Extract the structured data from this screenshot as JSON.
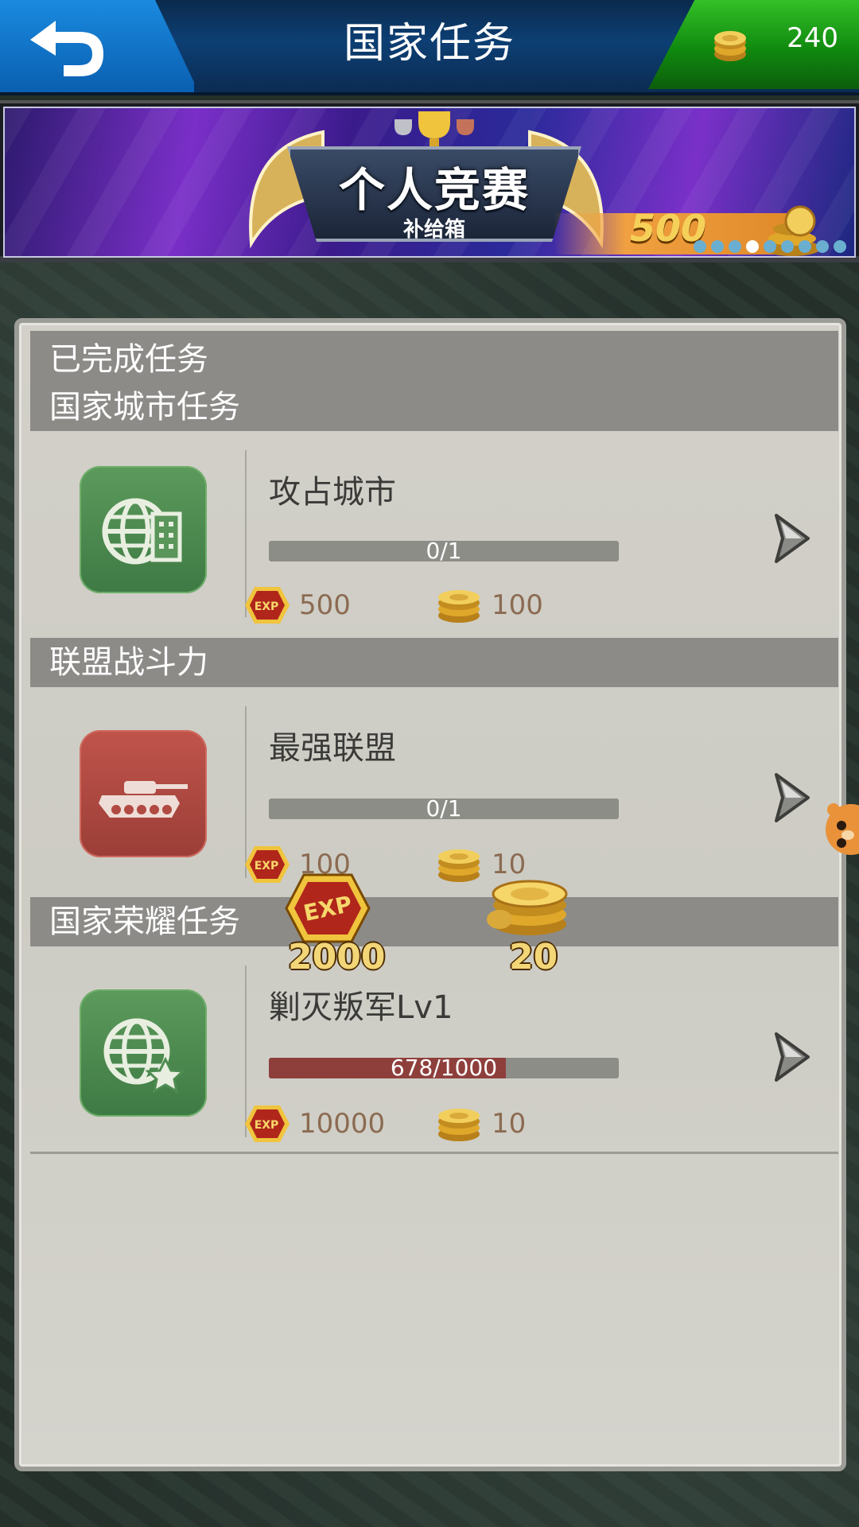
{
  "header": {
    "title": "国家任务",
    "back_icon": "back-arrow-icon",
    "currency": {
      "icon": "gold-coin-icon",
      "value": "240"
    }
  },
  "banner": {
    "title": "个人竞赛",
    "subtitle": "补给箱",
    "amount": "500",
    "page_count": 9,
    "active_index": 3
  },
  "sections": {
    "completed": "已完成任务",
    "city": "国家城市任务",
    "alliance": "联盟战斗力",
    "glory": "国家荣耀任务"
  },
  "tasks": [
    {
      "name": "攻占城市",
      "progress_text": "0/1",
      "progress_fraction": 0.0,
      "exp": "500",
      "coins": "100",
      "icon": "globe-city-icon",
      "color": "#4f8c52"
    },
    {
      "name": "最强联盟",
      "progress_text": "0/1",
      "progress_fraction": 0.0,
      "exp": "100",
      "coins": "10",
      "icon": "tank-icon",
      "color": "#b04a42"
    },
    {
      "name": "剿灭叛军Lv1",
      "progress_text": "678/1000",
      "progress_fraction": 0.678,
      "exp": "10000",
      "coins": "10",
      "icon": "globe-star-icon",
      "color": "#4f8c52"
    }
  ],
  "floating_rewards": {
    "exp": "2000",
    "coins": "20"
  },
  "colors": {
    "header_blue": "#0d3f74",
    "currency_green": "#108a0f",
    "progress_fill": "#8e3f3c",
    "reward_text": "#8b6b52"
  }
}
